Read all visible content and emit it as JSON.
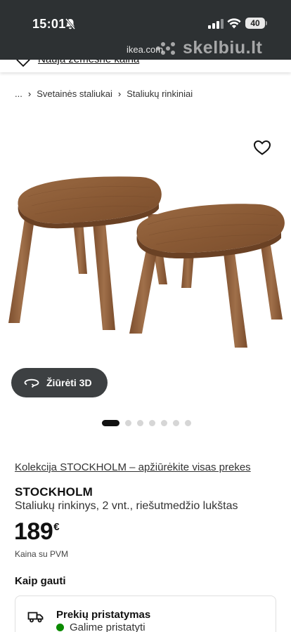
{
  "status_bar": {
    "time": "15:01",
    "battery": "40",
    "url": "ikea.com",
    "watermark": "skelbiu.lt"
  },
  "promo": {
    "link": "Nauja žemesnė kaina"
  },
  "breadcrumb": {
    "items": [
      "...",
      "Svetainės staliukai",
      "Staliukų rinkiniai"
    ]
  },
  "media": {
    "view3d_label": "Žiūrėti 3D",
    "image_count": 7,
    "active_index": 0
  },
  "product": {
    "collection_link": "Kolekcija STOCKHOLM – apžiūrėkite visas prekes",
    "name": "STOCKHOLM",
    "description": "Staliukų rinkinys, 2 vnt., riešutmedžio lukštas",
    "price": "189",
    "currency": "€",
    "price_note": "Kaina su PVM"
  },
  "availability": {
    "title": "Kaip gauti",
    "delivery_title": "Prekių pristatymas",
    "delivery_status": "Galime pristatyti",
    "status_color": "#0a8a00"
  },
  "colors": {
    "status_bar_bg": "#2d3133",
    "button_dark": "#3d4042",
    "wood": "#8a5a35"
  }
}
